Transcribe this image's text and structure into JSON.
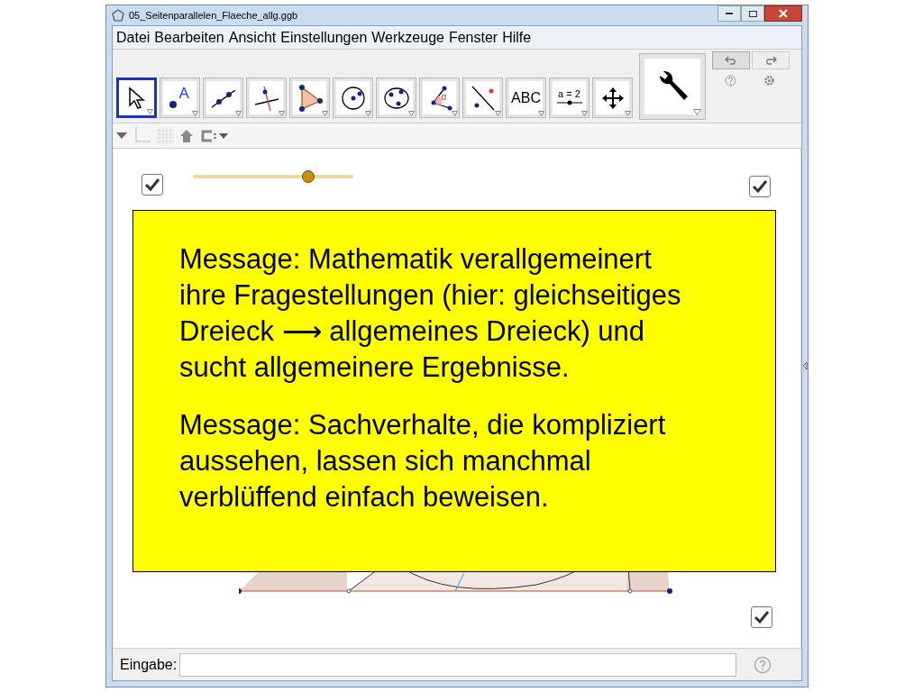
{
  "window": {
    "title": "05_Seitenparallelen_Flaeche_allg.ggb"
  },
  "menu": [
    "Datei",
    "Bearbeiten",
    "Ansicht",
    "Einstellungen",
    "Werkzeuge",
    "Fenster",
    "Hilfe"
  ],
  "tools": [
    {
      "kind": "move",
      "selected": true
    },
    {
      "kind": "point",
      "label": "A",
      "selected": false
    },
    {
      "kind": "line",
      "selected": false
    },
    {
      "kind": "perpendicular",
      "selected": false
    },
    {
      "kind": "polygon",
      "selected": false
    },
    {
      "kind": "circle",
      "selected": false
    },
    {
      "kind": "conic",
      "selected": false
    },
    {
      "kind": "angle",
      "label": "α",
      "selected": false
    },
    {
      "kind": "reflect",
      "selected": false
    },
    {
      "kind": "text",
      "label": "ABC",
      "selected": false
    },
    {
      "kind": "slider",
      "label": "a = 2",
      "selected": false
    },
    {
      "kind": "pan",
      "selected": false
    }
  ],
  "canvas": {
    "checkboxes": [
      {
        "checked": true
      },
      {
        "checked": true
      },
      {
        "checked": true
      }
    ],
    "slider": {
      "level": 0.72
    },
    "message": [
      "Message: Mathematik verallgemeinert ihre Fragestellungen (hier: gleichseitiges Dreieck ⟶ allgemeines Dreieck) und sucht allgemeinere Ergebnisse.",
      "Message: Sachverhalte, die kompliziert aussehen, lassen sich manchmal verblüffend einfach beweisen."
    ]
  },
  "input_bar": {
    "label": "Eingabe:"
  }
}
